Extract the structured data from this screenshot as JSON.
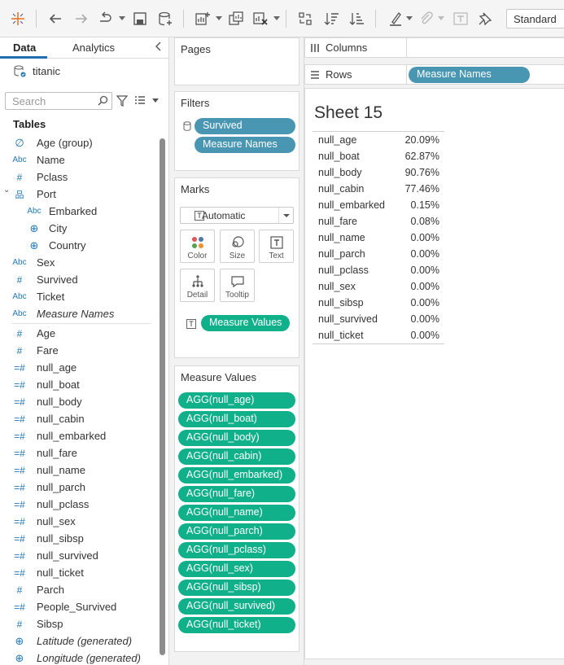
{
  "toolbar": {
    "fit_mode": "Standard"
  },
  "data_pane": {
    "tabs": {
      "data": "Data",
      "analytics": "Analytics"
    },
    "datasource": "titanic",
    "search_placeholder": "Search",
    "tables_heading": "Tables",
    "fields": [
      {
        "label": "Age (group)",
        "icon": "paperclip-icon",
        "glyph": "∅",
        "italic": false,
        "indent": 0
      },
      {
        "label": "Name",
        "icon": "string-abc-icon",
        "glyph": "Abc",
        "italic": false,
        "indent": 0
      },
      {
        "label": "Pclass",
        "icon": "number-hash-icon",
        "glyph": "#",
        "italic": false,
        "indent": 0
      },
      {
        "label": "Port",
        "icon": "hierarchy-icon",
        "glyph": "品",
        "italic": false,
        "indent": 0,
        "expanded": true
      },
      {
        "label": "Embarked",
        "icon": "string-abc-icon",
        "glyph": "Abc",
        "italic": false,
        "indent": 1
      },
      {
        "label": "City",
        "icon": "geo-globe-icon",
        "glyph": "⊕",
        "italic": false,
        "indent": 1
      },
      {
        "label": "Country",
        "icon": "geo-globe-icon",
        "glyph": "⊕",
        "italic": false,
        "indent": 1
      },
      {
        "label": "Sex",
        "icon": "string-abc-icon",
        "glyph": "Abc",
        "italic": false,
        "indent": 0
      },
      {
        "label": "Survived",
        "icon": "number-hash-icon",
        "glyph": "#",
        "italic": false,
        "indent": 0
      },
      {
        "label": "Ticket",
        "icon": "string-abc-icon",
        "glyph": "Abc",
        "italic": false,
        "indent": 0
      },
      {
        "label": "Measure Names",
        "icon": "string-abc-icon",
        "glyph": "Abc",
        "italic": true,
        "indent": 0
      },
      {
        "divider": true
      },
      {
        "label": "Age",
        "icon": "number-hash-icon",
        "glyph": "#",
        "italic": false,
        "indent": 0,
        "measure": true
      },
      {
        "label": "Fare",
        "icon": "number-hash-icon",
        "glyph": "#",
        "italic": false,
        "indent": 0,
        "measure": true
      },
      {
        "label": "null_age",
        "icon": "calc-hash-icon",
        "glyph": "=#",
        "italic": false,
        "indent": 0,
        "measure": true
      },
      {
        "label": "null_boat",
        "icon": "calc-hash-icon",
        "glyph": "=#",
        "italic": false,
        "indent": 0,
        "measure": true
      },
      {
        "label": "null_body",
        "icon": "calc-hash-icon",
        "glyph": "=#",
        "italic": false,
        "indent": 0,
        "measure": true
      },
      {
        "label": "null_cabin",
        "icon": "calc-hash-icon",
        "glyph": "=#",
        "italic": false,
        "indent": 0,
        "measure": true
      },
      {
        "label": "null_embarked",
        "icon": "calc-hash-icon",
        "glyph": "=#",
        "italic": false,
        "indent": 0,
        "measure": true
      },
      {
        "label": "null_fare",
        "icon": "calc-hash-icon",
        "glyph": "=#",
        "italic": false,
        "indent": 0,
        "measure": true
      },
      {
        "label": "null_name",
        "icon": "calc-hash-icon",
        "glyph": "=#",
        "italic": false,
        "indent": 0,
        "measure": true
      },
      {
        "label": "null_parch",
        "icon": "calc-hash-icon",
        "glyph": "=#",
        "italic": false,
        "indent": 0,
        "measure": true
      },
      {
        "label": "null_pclass",
        "icon": "calc-hash-icon",
        "glyph": "=#",
        "italic": false,
        "indent": 0,
        "measure": true
      },
      {
        "label": "null_sex",
        "icon": "calc-hash-icon",
        "glyph": "=#",
        "italic": false,
        "indent": 0,
        "measure": true
      },
      {
        "label": "null_sibsp",
        "icon": "calc-hash-icon",
        "glyph": "=#",
        "italic": false,
        "indent": 0,
        "measure": true
      },
      {
        "label": "null_survived",
        "icon": "calc-hash-icon",
        "glyph": "=#",
        "italic": false,
        "indent": 0,
        "measure": true
      },
      {
        "label": "null_ticket",
        "icon": "calc-hash-icon",
        "glyph": "=#",
        "italic": false,
        "indent": 0,
        "measure": true
      },
      {
        "label": "Parch",
        "icon": "number-hash-icon",
        "glyph": "#",
        "italic": false,
        "indent": 0,
        "measure": true
      },
      {
        "label": "People_Survived",
        "icon": "calc-hash-icon",
        "glyph": "=#",
        "italic": false,
        "indent": 0,
        "measure": true
      },
      {
        "label": "Sibsp",
        "icon": "number-hash-icon",
        "glyph": "#",
        "italic": false,
        "indent": 0,
        "measure": true
      },
      {
        "label": "Latitude (generated)",
        "icon": "geo-globe-icon",
        "glyph": "⊕",
        "italic": true,
        "indent": 0,
        "measure": true
      },
      {
        "label": "Longitude (generated)",
        "icon": "geo-globe-icon",
        "glyph": "⊕",
        "italic": true,
        "indent": 0,
        "measure": true
      }
    ]
  },
  "shelves": {
    "pages_title": "Pages",
    "filters_title": "Filters",
    "filters": [
      "Survived",
      "Measure Names"
    ],
    "marks_title": "Marks",
    "mark_type": "Automatic",
    "mark_buttons": [
      "Color",
      "Size",
      "Text",
      "Detail",
      "Tooltip"
    ],
    "marks_pill": "Measure Values",
    "measure_values_title": "Measure Values",
    "measure_values": [
      "AGG(null_age)",
      "AGG(null_boat)",
      "AGG(null_body)",
      "AGG(null_cabin)",
      "AGG(null_embarked)",
      "AGG(null_fare)",
      "AGG(null_name)",
      "AGG(null_parch)",
      "AGG(null_pclass)",
      "AGG(null_sex)",
      "AGG(null_sibsp)",
      "AGG(null_survived)",
      "AGG(null_ticket)"
    ],
    "columns_label": "Columns",
    "rows_label": "Rows",
    "rows_pill": "Measure Names"
  },
  "sheet": {
    "title": "Sheet 15",
    "rows": [
      {
        "name": "null_age",
        "value": "20.09%"
      },
      {
        "name": "null_boat",
        "value": "62.87%"
      },
      {
        "name": "null_body",
        "value": "90.76%"
      },
      {
        "name": "null_cabin",
        "value": "77.46%"
      },
      {
        "name": "null_embarked",
        "value": "0.15%"
      },
      {
        "name": "null_fare",
        "value": "0.08%"
      },
      {
        "name": "null_name",
        "value": "0.00%"
      },
      {
        "name": "null_parch",
        "value": "0.00%"
      },
      {
        "name": "null_pclass",
        "value": "0.00%"
      },
      {
        "name": "null_sex",
        "value": "0.00%"
      },
      {
        "name": "null_sibsp",
        "value": "0.00%"
      },
      {
        "name": "null_survived",
        "value": "0.00%"
      },
      {
        "name": "null_ticket",
        "value": "0.00%"
      }
    ]
  },
  "colors": {
    "dimension_pill": "#4996b2",
    "measure_pill": "#0fb08a",
    "field_icon": "#1f77b4",
    "accent_tab": "#1f6fb2"
  }
}
